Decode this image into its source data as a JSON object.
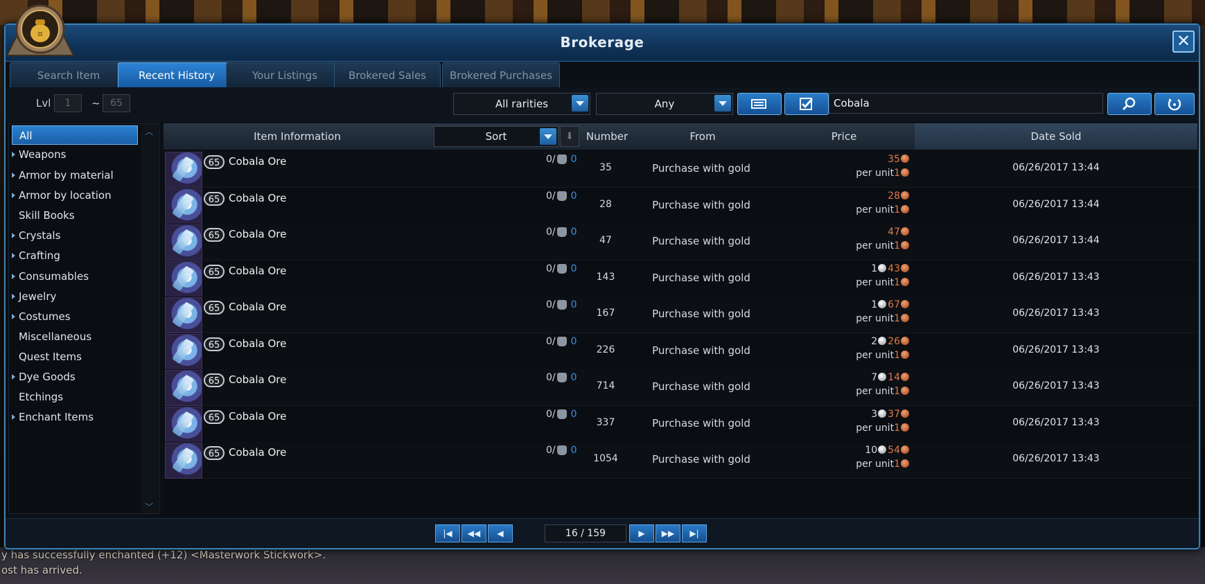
{
  "window": {
    "title": "Brokerage",
    "close_label": "✕"
  },
  "tabs": [
    {
      "label": "Search Item",
      "active": false
    },
    {
      "label": "Recent History",
      "active": true
    },
    {
      "label": "Your Listings",
      "active": false
    },
    {
      "label": "Brokered Sales",
      "active": false
    },
    {
      "label": "Brokered Purchases",
      "active": false
    }
  ],
  "filters": {
    "level_label": "Lvl",
    "level_min": "1",
    "level_separator": "~",
    "level_max": "65",
    "rarity": "All rarities",
    "type": "Any",
    "search_value": "Cobala"
  },
  "categories": [
    {
      "label": "All",
      "expandable": false,
      "active": true
    },
    {
      "label": "Weapons",
      "expandable": true
    },
    {
      "label": "Armor by material",
      "expandable": true
    },
    {
      "label": "Armor by location",
      "expandable": true
    },
    {
      "label": "Skill Books",
      "expandable": false
    },
    {
      "label": "Crystals",
      "expandable": true
    },
    {
      "label": "Crafting",
      "expandable": true
    },
    {
      "label": "Consumables",
      "expandable": true
    },
    {
      "label": "Jewelry",
      "expandable": true
    },
    {
      "label": "Costumes",
      "expandable": true
    },
    {
      "label": "Miscellaneous",
      "expandable": false
    },
    {
      "label": "Quest Items",
      "expandable": false
    },
    {
      "label": "Dye Goods",
      "expandable": true
    },
    {
      "label": "Etchings",
      "expandable": false
    },
    {
      "label": "Enchant Items",
      "expandable": true
    }
  ],
  "table": {
    "headers": {
      "item_information": "Item Information",
      "sort": "Sort",
      "number": "Number",
      "from": "From",
      "price": "Price",
      "date_sold": "Date Sold"
    },
    "rows": [
      {
        "level": "65",
        "name": "Cobala Ore",
        "stock": "0/",
        "stock_count": "0",
        "number": "35",
        "from": "Purchase with gold",
        "silver": "",
        "copper": "35",
        "per_unit_label": "per unit",
        "per_unit": "1",
        "date": "06/26/2017 13:44"
      },
      {
        "level": "65",
        "name": "Cobala Ore",
        "stock": "0/",
        "stock_count": "0",
        "number": "28",
        "from": "Purchase with gold",
        "silver": "",
        "copper": "28",
        "per_unit_label": "per unit",
        "per_unit": "1",
        "date": "06/26/2017 13:44"
      },
      {
        "level": "65",
        "name": "Cobala Ore",
        "stock": "0/",
        "stock_count": "0",
        "number": "47",
        "from": "Purchase with gold",
        "silver": "",
        "copper": "47",
        "per_unit_label": "per unit",
        "per_unit": "1",
        "date": "06/26/2017 13:44"
      },
      {
        "level": "65",
        "name": "Cobala Ore",
        "stock": "0/",
        "stock_count": "0",
        "number": "143",
        "from": "Purchase with gold",
        "silver": "1",
        "copper": "43",
        "per_unit_label": "per unit",
        "per_unit": "1",
        "date": "06/26/2017 13:43"
      },
      {
        "level": "65",
        "name": "Cobala Ore",
        "stock": "0/",
        "stock_count": "0",
        "number": "167",
        "from": "Purchase with gold",
        "silver": "1",
        "copper": "67",
        "per_unit_label": "per unit",
        "per_unit": "1",
        "date": "06/26/2017 13:43"
      },
      {
        "level": "65",
        "name": "Cobala Ore",
        "stock": "0/",
        "stock_count": "0",
        "number": "226",
        "from": "Purchase with gold",
        "silver": "2",
        "copper": "26",
        "per_unit_label": "per unit",
        "per_unit": "1",
        "date": "06/26/2017 13:43"
      },
      {
        "level": "65",
        "name": "Cobala Ore",
        "stock": "0/",
        "stock_count": "0",
        "number": "714",
        "from": "Purchase with gold",
        "silver": "7",
        "copper": "14",
        "per_unit_label": "per unit",
        "per_unit": "1",
        "date": "06/26/2017 13:43"
      },
      {
        "level": "65",
        "name": "Cobala Ore",
        "stock": "0/",
        "stock_count": "0",
        "number": "337",
        "from": "Purchase with gold",
        "silver": "3",
        "copper": "37",
        "per_unit_label": "per unit",
        "per_unit": "1",
        "date": "06/26/2017 13:43"
      },
      {
        "level": "65",
        "name": "Cobala Ore",
        "stock": "0/",
        "stock_count": "0",
        "number": "1054",
        "from": "Purchase with gold",
        "silver": "10",
        "copper": "54",
        "per_unit_label": "per unit",
        "per_unit": "1",
        "date": "06/26/2017 13:43"
      }
    ]
  },
  "pagination": {
    "label": "16 / 159"
  },
  "chat": {
    "line1": "y has successfully enchanted (+12) <Masterwork Stickwork>.",
    "line2": "ost has arrived."
  },
  "colors": {
    "accent": "#2b81d0",
    "copper": "#e07a45",
    "stock_count": "#3a8fe6"
  },
  "icons": {
    "close": "close-icon",
    "search": "search-icon",
    "reset": "reset-icon",
    "filter_view": "view-mode-icon",
    "checkbox": "checkbox-icon",
    "bag": "storage-bag-icon",
    "emblem": "gold-pouch-icon"
  }
}
